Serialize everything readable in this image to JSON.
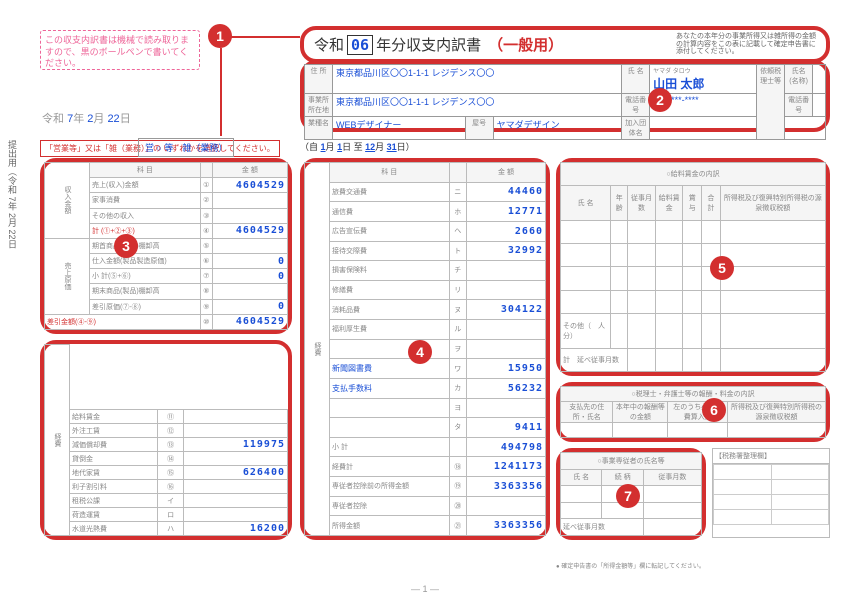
{
  "side_text": "提出用（令和 7年 2月 22日",
  "warn_box": "この収支内訳書は機械で読み取りますので、黒のボールペンで書いてください。",
  "date": {
    "era": "令和",
    "y": "7",
    "ml": "2",
    "d": "22"
  },
  "title": {
    "era": "令和",
    "yr": "06",
    "label": "年分収支内訳書",
    "part": "（一般用）",
    "note": "あなたの本年分の事業所得又は雑所得の金額の計算内容をこの表に記載して確定申告書に添付してください。"
  },
  "markers": {
    "m1": "1",
    "m2": "2",
    "m3": "3",
    "m4": "4",
    "m5": "5",
    "m6": "6",
    "m7": "7"
  },
  "info": {
    "addr_l": "住 所",
    "addr": "東京都品川区〇〇1-1-1\nレジデンス〇〇",
    "biz_l": "事業所\n所在地",
    "biz": "東京都品川区〇〇1-1-1\nレジデンス〇〇",
    "job_l": "業種名",
    "job": "WEBデザイナー",
    "shop_l": "屋号",
    "shop": "ヤマダデザイン",
    "name_l": "氏 名",
    "ruby": "ヤマダ タロウ",
    "name": "山田 太郎",
    "tel_l": "電話番号",
    "tel": "180-***-****",
    "org_l": "加入団体名",
    "dep_l": "依頼税理士等",
    "dep_name_l": "氏名(名称)",
    "dep_tel_l": "電話番号"
  },
  "accounting": {
    "note": "「営業等」又は「雑（業務）」の\nいずれかを選択してください。",
    "sel": "営 ○ 等　雑（業務）"
  },
  "period": {
    "pre": "（自",
    "m1": "1",
    "d1": "1",
    "mid": "日 至",
    "m2": "12",
    "d2": "31",
    "post": "日）"
  },
  "box3": {
    "hdr": [
      "科 目",
      "金 額"
    ],
    "side": "収入金額",
    "rows": [
      {
        "l": "売上(収入)金額",
        "n": "①",
        "v": "4604529"
      },
      {
        "l": "家事消費",
        "n": "②",
        "v": ""
      },
      {
        "l": "その他の収入",
        "n": "③",
        "v": ""
      },
      {
        "l": "計 (①+②+③)",
        "n": "④",
        "v": "4604529",
        "cls": "red"
      }
    ],
    "side2": "売上原価",
    "rows2": [
      {
        "l": "期首商品(製品)棚卸高",
        "n": "⑤",
        "v": ""
      },
      {
        "l": "仕入金額(製品製造原価)",
        "n": "⑥",
        "v": "0"
      },
      {
        "l": "小 計(⑤+⑥)",
        "n": "⑦",
        "v": "0"
      },
      {
        "l": "期末商品(製品)棚卸高",
        "n": "⑧",
        "v": ""
      },
      {
        "l": "差引原価(⑦-⑧)",
        "n": "⑨",
        "v": "0"
      }
    ],
    "foot": {
      "l": "差引金額(④-⑨)",
      "n": "⑩",
      "v": "4604529"
    }
  },
  "under3": {
    "side": "経費",
    "rows": [
      {
        "l": "給料賃金",
        "n": "⑪",
        "v": ""
      },
      {
        "l": "外注工賃",
        "n": "⑫",
        "v": ""
      },
      {
        "l": "減価償却費",
        "n": "⑬",
        "v": "119975"
      },
      {
        "l": "貸倒金",
        "n": "⑭",
        "v": ""
      },
      {
        "l": "地代家賃",
        "n": "⑮",
        "v": "626400"
      },
      {
        "l": "利子割引料",
        "n": "⑯",
        "v": ""
      },
      {
        "l": "租税公課",
        "n": "イ",
        "v": ""
      },
      {
        "l": "荷造運賃",
        "n": "ロ",
        "v": ""
      },
      {
        "l": "水道光熱費",
        "n": "ハ",
        "v": "16200"
      }
    ]
  },
  "box4": {
    "hdr": [
      "科 目",
      "金 額"
    ],
    "side": "経費",
    "rows": [
      {
        "l": "旅費交通費",
        "n": "ニ",
        "v": "44460"
      },
      {
        "l": "通信費",
        "n": "ホ",
        "v": "12771"
      },
      {
        "l": "広告宣伝費",
        "n": "ヘ",
        "v": "2660"
      },
      {
        "l": "接待交際費",
        "n": "ト",
        "v": "32992"
      },
      {
        "l": "損害保険料",
        "n": "チ",
        "v": ""
      },
      {
        "l": "修繕費",
        "n": "リ",
        "v": ""
      },
      {
        "l": "消耗品費",
        "n": "ヌ",
        "v": "304122"
      },
      {
        "l": "福利厚生費",
        "n": "ル",
        "v": ""
      },
      {
        "l": "",
        "n": "ヲ",
        "v": ""
      },
      {
        "l": "新聞図書費",
        "n": "ワ",
        "v": "15950",
        "cls": "b"
      },
      {
        "l": "支払手数料",
        "n": "カ",
        "v": "56232",
        "cls": "b"
      },
      {
        "l": "",
        "n": "ヨ",
        "v": ""
      },
      {
        "l": "",
        "n": "タ",
        "v": "9411"
      },
      {
        "l": "小 計",
        "n": "",
        "v": "494798"
      },
      {
        "l": "経費計",
        "n": "⑱",
        "v": "1241173"
      },
      {
        "l": "専従者控除前の所得金額",
        "n": "⑲",
        "v": "3363356"
      },
      {
        "l": "専従者控除",
        "n": "⑳",
        "v": ""
      },
      {
        "l": "所得金額",
        "n": "㉑",
        "v": "3363356"
      }
    ]
  },
  "box5": {
    "title": "○給料賃金の内訳",
    "hdr": [
      "氏 名",
      "年齢",
      "従事月数",
      "給料賃金",
      "賞 与",
      "合 計",
      "所得税及び復興特別所得税の源泉徴収税額"
    ],
    "other": "その他（　人分）",
    "total": "計　延べ従事月数"
  },
  "box6": {
    "title": "○税理士・弁護士等の報酬・料金の内訳",
    "hdr": [
      "支払先の住所・氏名",
      "本年中の報酬等の金額",
      "左のうち必要経費算入額",
      "所得税及び復興特別所得税の源泉徴収税額"
    ]
  },
  "box7": {
    "title": "○事業専従者の氏名等",
    "hdr": [
      "氏 名",
      "続 柄",
      "従事月数"
    ],
    "foot": "延べ従事月数"
  },
  "admin": "【税務署整理欄】",
  "page": "— 1 —",
  "bottom_note": "● 確定申告書の「所得金額等」欄に転記してください。"
}
